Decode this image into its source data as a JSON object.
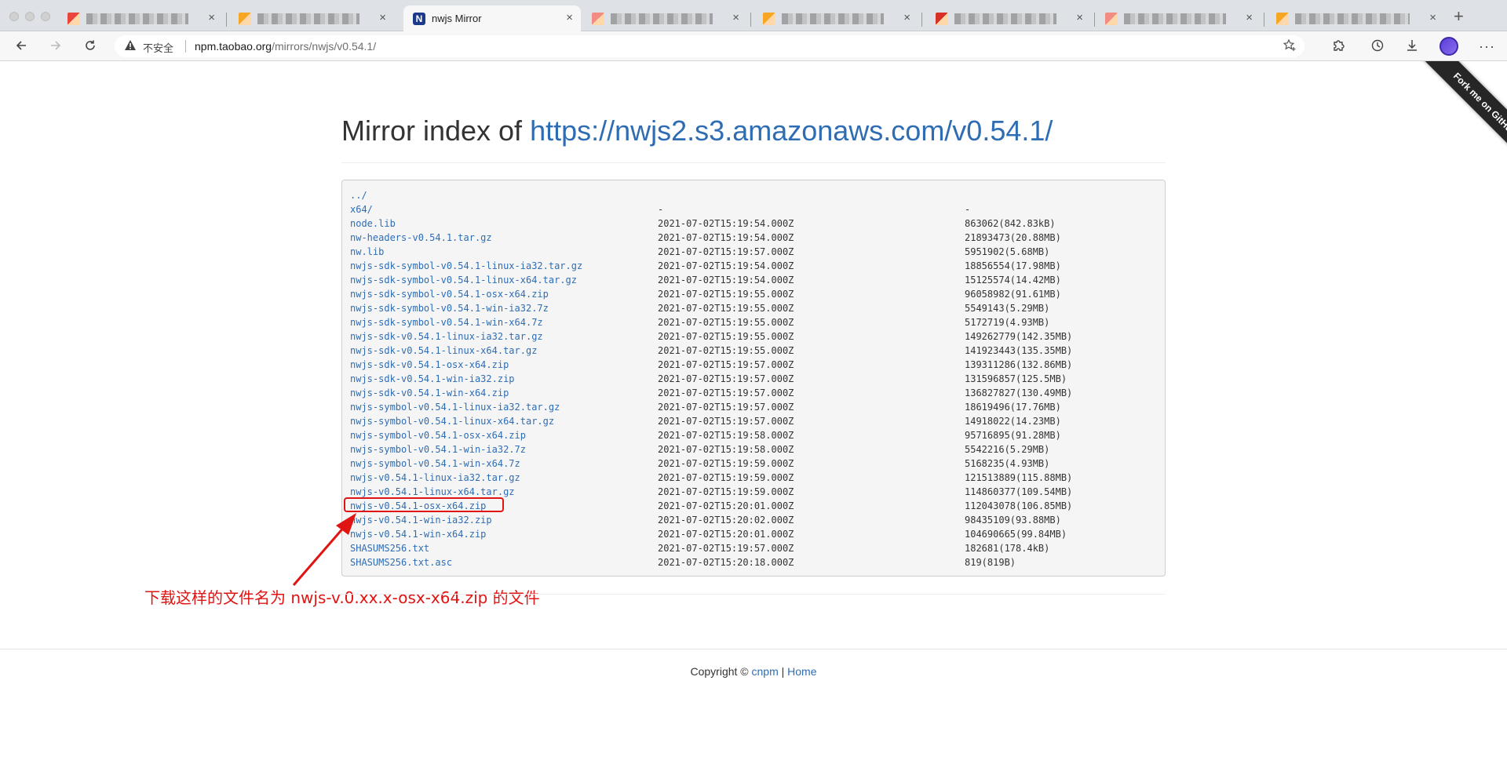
{
  "browser": {
    "tabs": [
      {
        "title": "",
        "active": false,
        "favicon_color": "#e8453c"
      },
      {
        "title": "",
        "active": false,
        "favicon_color": "#f6a623"
      },
      {
        "title": "nwjs Mirror",
        "active": true,
        "favicon_color": "#1d3a8a"
      },
      {
        "title": "",
        "active": false,
        "favicon_color": "#f28b82"
      },
      {
        "title": "",
        "active": false,
        "favicon_color": "#f6a623"
      },
      {
        "title": "",
        "active": false,
        "favicon_color": "#d93025"
      },
      {
        "title": "",
        "active": false,
        "favicon_color": "#f28b82"
      },
      {
        "title": "",
        "active": false,
        "favicon_color": "#f6a623"
      }
    ],
    "active_tab_favicon_letter": "N",
    "insecure_label": "不安全",
    "url_host": "npm.taobao.org",
    "url_path": "/mirrors/nwjs/v0.54.1/",
    "icons": {
      "back": "back-arrow-icon",
      "forward": "forward-arrow-icon",
      "reload": "reload-icon",
      "star": "favorite-star-icon",
      "extensions": "extensions-icon",
      "history": "history-icon",
      "download": "download-icon",
      "menu": "more-menu-icon"
    }
  },
  "page": {
    "heading_prefix": "Mirror index of ",
    "heading_link": "https://nwjs2.s3.amazonaws.com/v0.54.1/",
    "ribbon_text": "Fork me on GitHub",
    "files": [
      {
        "name": "../",
        "date": "",
        "size": ""
      },
      {
        "name": "x64/",
        "date": "-",
        "size": "-"
      },
      {
        "name": "node.lib",
        "date": "2021-07-02T15:19:54.000Z",
        "size": "863062(842.83kB)"
      },
      {
        "name": "nw-headers-v0.54.1.tar.gz",
        "date": "2021-07-02T15:19:54.000Z",
        "size": "21893473(20.88MB)"
      },
      {
        "name": "nw.lib",
        "date": "2021-07-02T15:19:57.000Z",
        "size": "5951902(5.68MB)"
      },
      {
        "name": "nwjs-sdk-symbol-v0.54.1-linux-ia32.tar.gz",
        "date": "2021-07-02T15:19:54.000Z",
        "size": "18856554(17.98MB)"
      },
      {
        "name": "nwjs-sdk-symbol-v0.54.1-linux-x64.tar.gz",
        "date": "2021-07-02T15:19:54.000Z",
        "size": "15125574(14.42MB)"
      },
      {
        "name": "nwjs-sdk-symbol-v0.54.1-osx-x64.zip",
        "date": "2021-07-02T15:19:55.000Z",
        "size": "96058982(91.61MB)"
      },
      {
        "name": "nwjs-sdk-symbol-v0.54.1-win-ia32.7z",
        "date": "2021-07-02T15:19:55.000Z",
        "size": "5549143(5.29MB)"
      },
      {
        "name": "nwjs-sdk-symbol-v0.54.1-win-x64.7z",
        "date": "2021-07-02T15:19:55.000Z",
        "size": "5172719(4.93MB)"
      },
      {
        "name": "nwjs-sdk-v0.54.1-linux-ia32.tar.gz",
        "date": "2021-07-02T15:19:55.000Z",
        "size": "149262779(142.35MB)"
      },
      {
        "name": "nwjs-sdk-v0.54.1-linux-x64.tar.gz",
        "date": "2021-07-02T15:19:55.000Z",
        "size": "141923443(135.35MB)"
      },
      {
        "name": "nwjs-sdk-v0.54.1-osx-x64.zip",
        "date": "2021-07-02T15:19:57.000Z",
        "size": "139311286(132.86MB)"
      },
      {
        "name": "nwjs-sdk-v0.54.1-win-ia32.zip",
        "date": "2021-07-02T15:19:57.000Z",
        "size": "131596857(125.5MB)"
      },
      {
        "name": "nwjs-sdk-v0.54.1-win-x64.zip",
        "date": "2021-07-02T15:19:57.000Z",
        "size": "136827827(130.49MB)"
      },
      {
        "name": "nwjs-symbol-v0.54.1-linux-ia32.tar.gz",
        "date": "2021-07-02T15:19:57.000Z",
        "size": "18619496(17.76MB)"
      },
      {
        "name": "nwjs-symbol-v0.54.1-linux-x64.tar.gz",
        "date": "2021-07-02T15:19:57.000Z",
        "size": "14918022(14.23MB)"
      },
      {
        "name": "nwjs-symbol-v0.54.1-osx-x64.zip",
        "date": "2021-07-02T15:19:58.000Z",
        "size": "95716895(91.28MB)"
      },
      {
        "name": "nwjs-symbol-v0.54.1-win-ia32.7z",
        "date": "2021-07-02T15:19:58.000Z",
        "size": "5542216(5.29MB)"
      },
      {
        "name": "nwjs-symbol-v0.54.1-win-x64.7z",
        "date": "2021-07-02T15:19:59.000Z",
        "size": "5168235(4.93MB)"
      },
      {
        "name": "nwjs-v0.54.1-linux-ia32.tar.gz",
        "date": "2021-07-02T15:19:59.000Z",
        "size": "121513889(115.88MB)"
      },
      {
        "name": "nwjs-v0.54.1-linux-x64.tar.gz",
        "date": "2021-07-02T15:19:59.000Z",
        "size": "114860377(109.54MB)"
      },
      {
        "name": "nwjs-v0.54.1-osx-x64.zip",
        "date": "2021-07-02T15:20:01.000Z",
        "size": "112043078(106.85MB)"
      },
      {
        "name": "nwjs-v0.54.1-win-ia32.zip",
        "date": "2021-07-02T15:20:02.000Z",
        "size": "98435109(93.88MB)"
      },
      {
        "name": "nwjs-v0.54.1-win-x64.zip",
        "date": "2021-07-02T15:20:01.000Z",
        "size": "104690665(99.84MB)"
      },
      {
        "name": "SHASUMS256.txt",
        "date": "2021-07-02T15:19:57.000Z",
        "size": "182681(178.4kB)"
      },
      {
        "name": "SHASUMS256.txt.asc",
        "date": "2021-07-02T15:20:18.000Z",
        "size": "819(819B)"
      }
    ],
    "annotation": {
      "text": "下载这样的文件名为 nwjs-v.0.xx.x-osx-x64.zip 的文件",
      "color": "#e11414"
    },
    "footer": {
      "copyright": "Copyright © ",
      "cnpm_link": "cnpm",
      "separator": " | ",
      "home_link": "Home"
    }
  },
  "colors": {
    "link": "#2e6db4",
    "annotation": "#e11414"
  }
}
